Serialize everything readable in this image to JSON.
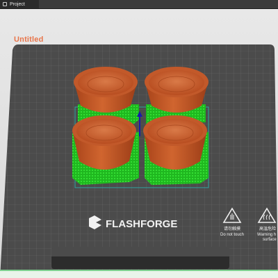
{
  "window": {
    "tab_label": "Project"
  },
  "viewport": {
    "project_name": "Untitled"
  },
  "plate": {
    "brand": "FLASHFORGE",
    "warnings": [
      {
        "icon": "hand-warning-icon",
        "cn": "请勿触摸",
        "en": "Do not touch"
      },
      {
        "icon": "hot-surface-icon",
        "cn": "高温危险",
        "en": "Warning h",
        "en2": "surface"
      }
    ]
  },
  "model": {
    "object_count": 4,
    "object_color": "#c8582a",
    "support_color": "#22cc22"
  }
}
